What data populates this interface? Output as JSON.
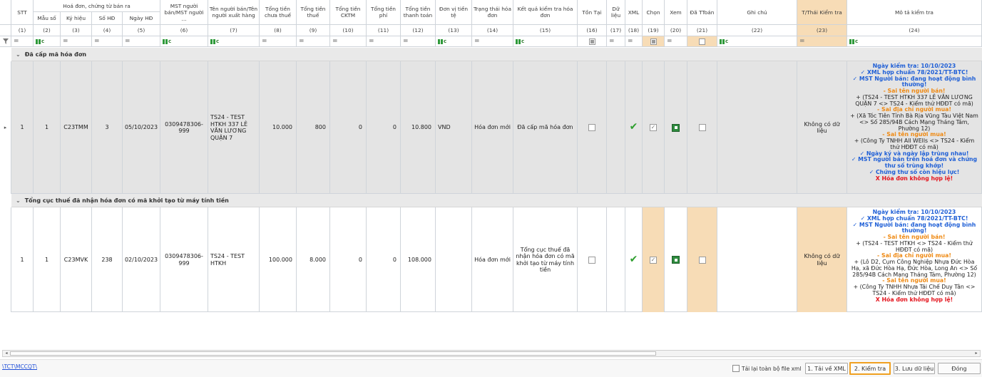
{
  "columns": [
    {
      "key": "stt",
      "label": "STT",
      "num": "(1)"
    },
    {
      "key": "mau_so",
      "label": "Mẫu số",
      "num": "(2)"
    },
    {
      "key": "ky_hieu",
      "label": "Ký hiệu",
      "num": "(3)"
    },
    {
      "key": "so_hd",
      "label": "Số HĐ",
      "num": "(4)"
    },
    {
      "key": "ngay_hd",
      "label": "Ngày HĐ",
      "num": "(5)"
    },
    {
      "key": "mst_ban",
      "label": "MST người bán/MST người ...",
      "num": "(6)"
    },
    {
      "key": "ten_ban",
      "label": "Tên người bán/Tên người xuất hàng",
      "num": "(7)"
    },
    {
      "key": "chua_thue",
      "label": "Tổng tiền chưa thuế",
      "num": "(8)"
    },
    {
      "key": "thue",
      "label": "Tổng tiền thuế",
      "num": "(9)"
    },
    {
      "key": "cktm",
      "label": "Tổng tiền CKTM",
      "num": "(10)"
    },
    {
      "key": "phi",
      "label": "Tổng tiền phí",
      "num": "(11)"
    },
    {
      "key": "thanh_toan",
      "label": "Tổng tiền thanh toán",
      "num": "(12)"
    },
    {
      "key": "don_vi",
      "label": "Đơn vị tiền tệ",
      "num": "(13)"
    },
    {
      "key": "trang_thai",
      "label": "Trạng thái hóa đơn",
      "num": "(14)"
    },
    {
      "key": "ket_qua",
      "label": "Kết quả kiểm tra hóa đơn",
      "num": "(15)"
    },
    {
      "key": "ton_tai",
      "label": "Tồn Tại",
      "num": "(16)"
    },
    {
      "key": "du_lieu",
      "label": "Dữ liệu",
      "num": "(17)"
    },
    {
      "key": "xml",
      "label": "XML",
      "num": "(18)"
    },
    {
      "key": "chon",
      "label": "Chọn",
      "num": "(19)"
    },
    {
      "key": "xem",
      "label": "Xem",
      "num": "(20)"
    },
    {
      "key": "da_ttoan",
      "label": "Đã TToán",
      "num": "(21)"
    },
    {
      "key": "ghi_chu",
      "label": "Ghi chú",
      "num": "(22)"
    },
    {
      "key": "tt_kiem_tra",
      "label": "T/Thái Kiểm tra",
      "num": "(23)"
    },
    {
      "key": "mo_ta",
      "label": "Mô tả kiểm tra",
      "num": "(24)"
    }
  ],
  "group_header": "Hoá đơn, chứng từ bán ra",
  "groups": [
    {
      "title": "Đã cấp mã hóa đơn",
      "row": {
        "stt": "1",
        "mau_so": "1",
        "ky_hieu": "C23TMM",
        "so_hd": "3",
        "ngay_hd": "05/10/2023",
        "mst_ban": "0309478306-999",
        "ten_ban": "TS24 - TEST HTKH 337 LÊ VĂN LƯƠNG QUẬN 7",
        "chua_thue": "10.000",
        "thue": "800",
        "cktm": "0",
        "phi": "0",
        "thanh_toan": "10.800",
        "don_vi": "VND",
        "trang_thai": "Hóa đơn mới",
        "ket_qua": "Đã cấp mã hóa đơn",
        "tt_kiem_tra": "Không có dữ liệu",
        "desc": [
          {
            "c": "blue",
            "t": "Ngày kiểm tra: 10/10/2023"
          },
          {
            "c": "blue",
            "t": "✓ XML hợp chuẩn 78/2021/TT-BTC!"
          },
          {
            "c": "blue",
            "t": "✓ MST Người bán: đang hoạt động bình thường!"
          },
          {
            "c": "orange",
            "t": "- Sai tên người bán!"
          },
          {
            "c": "black",
            "t": "+ (TS24 - TEST HTKH 337 LÊ VĂN LƯƠNG QUẬN 7 <> TS24 - Kiểm thử HĐĐT có mã)"
          },
          {
            "c": "orange",
            "t": "- Sai địa chỉ người mua!"
          },
          {
            "c": "black",
            "t": "+ (Xã Tóc Tiên Tỉnh Bà Rịa Vũng Tàu Việt Nam <> Số 285/94B Cách Mạng Tháng Tám, Phường 12)"
          },
          {
            "c": "orange",
            "t": "- Sai tên người mua!"
          },
          {
            "c": "black",
            "t": "+ (Công Ty TNHH All WElls <> TS24 - Kiểm thử HĐĐT có mã)"
          },
          {
            "c": "blue",
            "t": "✓ Ngày ký và ngày lập trùng nhau!"
          },
          {
            "c": "blue",
            "t": "✓ MST người bán trên hoá đơn và chứng thư số trùng khớp!"
          },
          {
            "c": "blue",
            "t": "✓ Chứng thư số còn hiệu lực!"
          },
          {
            "c": "red",
            "t": "X Hóa đơn không hợp lệ!"
          }
        ]
      }
    },
    {
      "title": "Tổng cục thuế đã nhận hóa đơn có mã khởi tạo từ máy tính tiền",
      "row": {
        "stt": "1",
        "mau_so": "1",
        "ky_hieu": "C23MVK",
        "so_hd": "238",
        "ngay_hd": "02/10/2023",
        "mst_ban": "0309478306-999",
        "ten_ban": "TS24 - TEST HTKH",
        "chua_thue": "100.000",
        "thue": "8.000",
        "cktm": "0",
        "phi": "0",
        "thanh_toan": "108.000",
        "don_vi": "",
        "trang_thai": "Hóa đơn mới",
        "ket_qua": "Tổng cục thuế đã nhận hóa đơn có mã khởi tạo từ máy tính tiền",
        "tt_kiem_tra": "Không có dữ liệu",
        "desc": [
          {
            "c": "blue",
            "t": "Ngày kiểm tra: 10/10/2023"
          },
          {
            "c": "blue",
            "t": "✓ XML hợp chuẩn 78/2021/TT-BTC!"
          },
          {
            "c": "blue",
            "t": "✓ MST Người bán: đang hoạt động bình thường!"
          },
          {
            "c": "orange",
            "t": "- Sai tên người bán!"
          },
          {
            "c": "black",
            "t": "+ (TS24 - TEST HTKH <> TS24 - Kiểm thử HĐĐT có mã)"
          },
          {
            "c": "orange",
            "t": "- Sai địa chỉ người mua!"
          },
          {
            "c": "black",
            "t": "+ (Lô D2, Cụm Công Nghiệp Nhựa Đức Hòa Hạ, xã Đức Hòa Hạ, Đức Hòa, Long An <> Số 285/94B Cách Mạng Tháng Tám, Phường 12)"
          },
          {
            "c": "orange",
            "t": "- Sai tên người mua!"
          },
          {
            "c": "black",
            "t": "+ (Công Ty TNHH Nhựa Tái Chế Duy Tân <> TS24 - Kiểm thử HĐĐT có mã)"
          },
          {
            "c": "red",
            "t": "X Hóa đơn không hợp lệ!"
          }
        ]
      }
    }
  ],
  "footer": {
    "link": "\\TCT\\MCCQT\\",
    "reload_label": "Tải lại toàn bộ file xml",
    "btn_download": "1. Tải về XML",
    "btn_check": "2. Kiểm tra",
    "btn_save": "3. Lưu dữ liệu",
    "btn_close": "Đóng"
  },
  "colors": {
    "peach": "#f7dcb6",
    "highlight": "#f0a020",
    "tick": "#2e9e2e"
  }
}
